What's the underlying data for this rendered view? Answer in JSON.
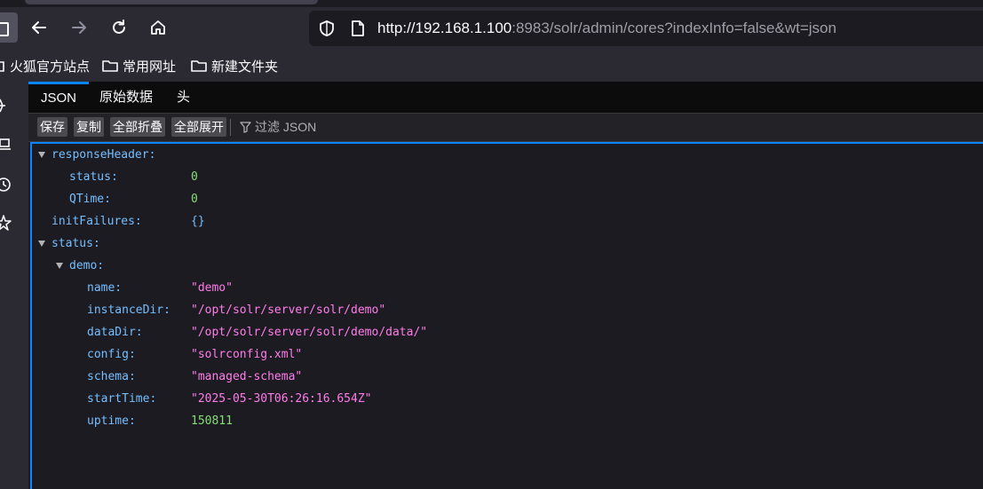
{
  "browser": {
    "url_host_part": "http://192.168.1.100",
    "url_rest": ":8983/solr/admin/cores?indexInfo=false&wt=json"
  },
  "bookmarks": [
    {
      "label": "火狐官方站点"
    },
    {
      "label": "常用网址"
    },
    {
      "label": "新建文件夹"
    }
  ],
  "viewer": {
    "tabs": [
      "JSON",
      "原始数据",
      "头"
    ],
    "toolbar": {
      "save": "保存",
      "copy": "复制",
      "collapse_all": "全部折叠",
      "expand_all": "全部展开",
      "filter_placeholder": "过滤 JSON"
    },
    "json": {
      "responseHeader_key": "responseHeader:",
      "status_key": "status:",
      "status_val": "0",
      "qtime_key": "QTime:",
      "qtime_val": "0",
      "initFailures_key": "initFailures:",
      "initFailures_val": "{}",
      "status_root_key": "status:",
      "demo_key": "demo:",
      "fields": [
        {
          "key": "name:",
          "value": "\"demo\""
        },
        {
          "key": "instanceDir:",
          "value": "\"/opt/solr/server/solr/demo\""
        },
        {
          "key": "dataDir:",
          "value": "\"/opt/solr/server/solr/demo/data/\""
        },
        {
          "key": "config:",
          "value": "\"solrconfig.xml\""
        },
        {
          "key": "schema:",
          "value": "\"managed-schema\""
        },
        {
          "key": "startTime:",
          "value": "\"2025-05-30T06:26:16.654Z\""
        },
        {
          "key": "uptime:",
          "value": "150811"
        }
      ]
    }
  },
  "colors": {
    "accent": "#0a84ff",
    "json_key": "#75bfff",
    "json_number": "#86de74",
    "json_string": "#ff7de9"
  }
}
